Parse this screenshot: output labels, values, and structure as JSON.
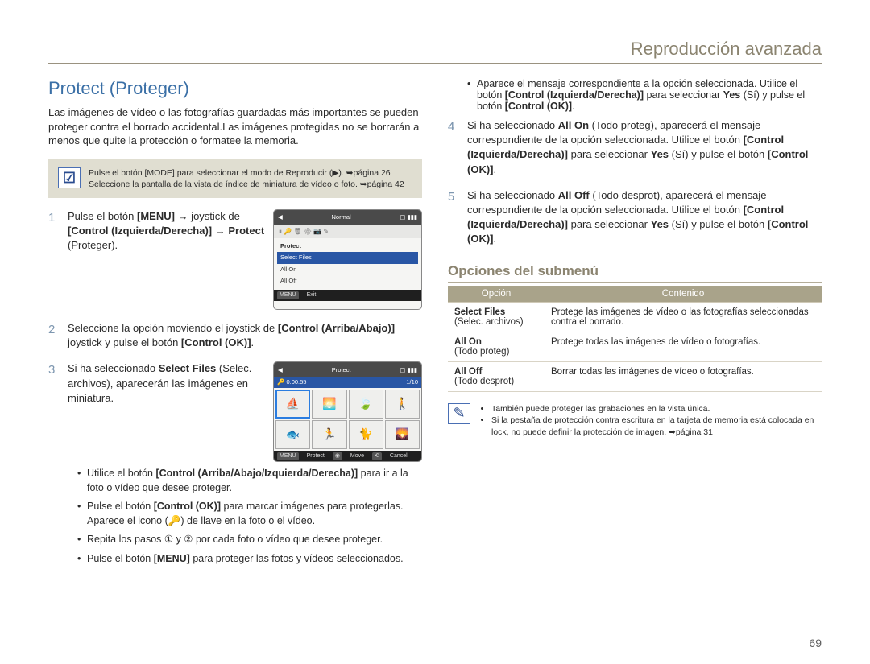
{
  "header": {
    "section": "Reproducción avanzada"
  },
  "title": "Protect (Proteger)",
  "intro": "Las imágenes de vídeo o las fotografías guardadas más importantes se pueden proteger contra el borrado accidental.Las imágenes protegidas no se borrarán a menos que quite la protección o formatee la memoria.",
  "infobox": {
    "lines": [
      "Pulse el botón [MODE] para seleccionar el modo de Reproducir (▶). ➥página 26",
      "Seleccione la pantalla de la vista de índice de miniatura de vídeo o foto. ➥página 42"
    ]
  },
  "steps_left": [
    {
      "parts": [
        "Pulse el botón ",
        {
          "b": "[MENU]"
        },
        " → joystick de ",
        {
          "b": "[Control (Izquierda/Derecha)]"
        },
        " → ",
        {
          "b": "Protect"
        },
        " (Proteger)."
      ]
    },
    {
      "parts": [
        "Seleccione la opción moviendo el joystick de ",
        {
          "b": "[Control (Arriba/Abajo)]"
        },
        " joystick y pulse el botón ",
        {
          "b": "[Control (OK)]"
        },
        "."
      ]
    },
    {
      "parts": [
        "Si ha seleccionado ",
        {
          "b": "Select Files"
        },
        " (Selec. archivos), aparecerán las imágenes en miniatura."
      ],
      "subitems": [
        {
          "parts": [
            "Utilice el botón ",
            {
              "b": "[Control (Arriba/Abajo/Izquierda/Derecha)]"
            },
            " para ir a la foto o vídeo que desee proteger."
          ]
        },
        {
          "parts": [
            "Pulse el botón ",
            {
              "b": "[Control (OK)]"
            },
            " para marcar imágenes para protegerlas. Aparece el icono (🔑) de llave en la foto o el vídeo."
          ]
        },
        {
          "parts": [
            "Repita los pasos ① y ② por cada foto o vídeo que desee proteger."
          ]
        },
        {
          "parts": [
            "Pulse el botón ",
            {
              "b": "[MENU]"
            },
            " para proteger las fotos y vídeos seleccionados."
          ]
        }
      ]
    }
  ],
  "steps_right": [
    {
      "bullet_before": {
        "parts": [
          "Aparece el mensaje correspondiente a la opción seleccionada. Utilice el botón ",
          {
            "b": "[Control (Izquierda/Derecha)]"
          },
          " para seleccionar ",
          {
            "b": "Yes"
          },
          " (Sí) y pulse el botón ",
          {
            "b": "[Control (OK)]"
          },
          "."
        ]
      },
      "num": "4",
      "parts": [
        "Si ha seleccionado ",
        {
          "b": "All On"
        },
        " (Todo proteg), aparecerá el mensaje correspondiente de la opción seleccionada. Utilice el botón ",
        {
          "b": "[Control (Izquierda/Derecha)]"
        },
        " para seleccionar ",
        {
          "b": "Yes"
        },
        " (Sí) y pulse el botón ",
        {
          "b": "[Control (OK)]"
        },
        "."
      ]
    },
    {
      "num": "5",
      "parts": [
        "Si ha seleccionado ",
        {
          "b": "All Off"
        },
        " (Todo desprot), aparecerá el mensaje correspondiente de la opción seleccionada. Utilice el botón ",
        {
          "b": "[Control (Izquierda/Derecha)]"
        },
        " para seleccionar ",
        {
          "b": "Yes"
        },
        " (Sí) y pulse el botón ",
        {
          "b": "[Control (OK)]"
        },
        "."
      ]
    }
  ],
  "submenu_header": "Opciones del submenú",
  "table": {
    "head": [
      "Opción",
      "Contenido"
    ],
    "rows": [
      {
        "name": "Select Files",
        "sub": "(Selec. archivos)",
        "desc": "Protege las imágenes de vídeo o las fotografías seleccionadas contra el borrado."
      },
      {
        "name": "All On",
        "sub": "(Todo proteg)",
        "desc": "Protege todas las imágenes de vídeo o fotografías."
      },
      {
        "name": "All Off",
        "sub": "(Todo desprot)",
        "desc": "Borrar todas las imágenes de vídeo o fotografías."
      }
    ]
  },
  "notes": [
    "También puede proteger las grabaciones en la vista única.",
    "Si la pestaña de protección contra escritura en la tarjeta de memoria está colocada en lock, no puede definir la protección de imagen. ➥página 31"
  ],
  "lcd1": {
    "topLeft": "◀",
    "topTitle": "Normal",
    "topRight": "▢ ▮▮▮",
    "icons": "⏸ 🔑 🗑 ⚙ 📷 ✎",
    "menu": [
      "Protect",
      "Select Files",
      "All On",
      "All Off"
    ],
    "selectedIndex": 1,
    "bottom": {
      "menu": "MENU",
      "menuLabel": "Exit"
    }
  },
  "lcd2": {
    "topLeft": "◀",
    "topTitle": "Protect",
    "topRight": "▢ ▮▮▮",
    "time": "0:00:55",
    "count": "1/10",
    "thumbs": [
      "⛵",
      "🌅",
      "🍃",
      "🚶",
      "🐟",
      "🏃",
      "🐈",
      "🌄"
    ],
    "selectedIndex": 0,
    "bottom": {
      "menu": "MENU",
      "menuLabel": "Protect",
      "ok": "◉",
      "okLabel": "Move",
      "back": "⟲",
      "backLabel": "Cancel"
    }
  },
  "pagenum": "69"
}
